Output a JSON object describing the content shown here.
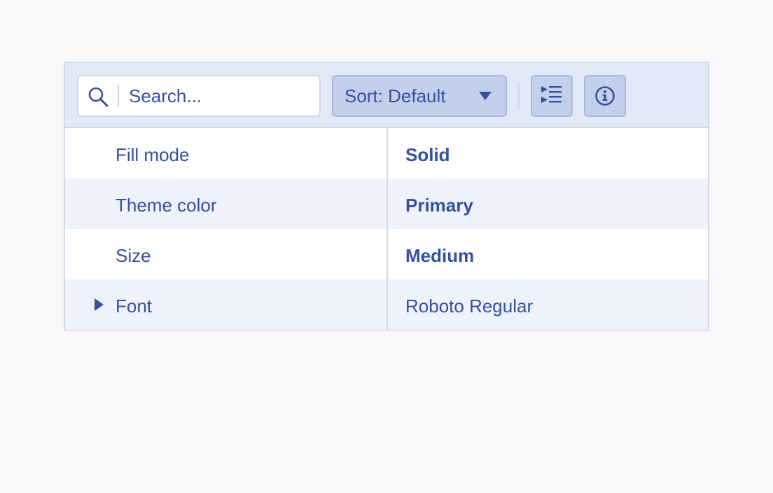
{
  "toolbar": {
    "search": {
      "placeholder": "Search...",
      "value": "",
      "icon": "search-icon"
    },
    "sort": {
      "label": "Sort: Default",
      "icon": "chevron-down-icon"
    },
    "expand_button_icon": "expand-all-icon",
    "info_button_icon": "info-icon"
  },
  "properties": [
    {
      "name": "Fill mode",
      "value": "Solid",
      "modified": true,
      "expandable": false
    },
    {
      "name": "Theme color",
      "value": "Primary",
      "modified": true,
      "expandable": false
    },
    {
      "name": "Size",
      "value": "Medium",
      "modified": true,
      "expandable": false
    },
    {
      "name": "Font",
      "value": "Roboto Regular",
      "modified": false,
      "expandable": true
    }
  ],
  "colors": {
    "text": "#3450a0",
    "toolbar_bg": "#e3e9f6",
    "button_bg": "#c3d0ec",
    "alt_row": "#eff2fb",
    "border": "#d0d8ec",
    "page_bg": "#f8f8fb"
  }
}
